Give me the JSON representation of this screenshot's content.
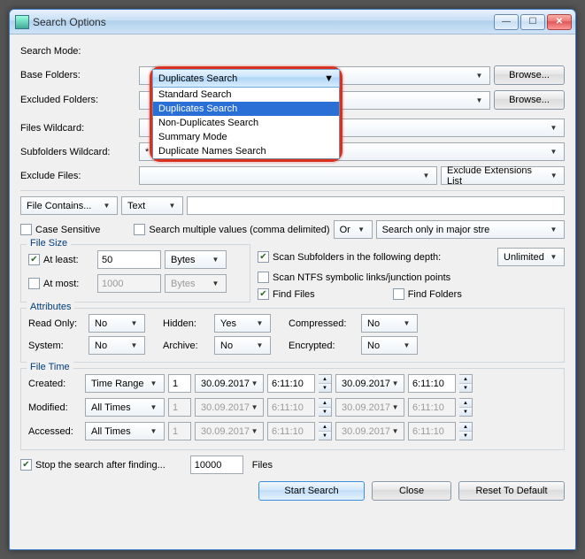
{
  "window": {
    "title": "Search Options"
  },
  "labels": {
    "searchMode": "Search Mode:",
    "baseFolders": "Base Folders:",
    "excludedFolders": "Excluded Folders:",
    "filesWildcard": "Files Wildcard:",
    "subfoldersWildcard": "Subfolders Wildcard:",
    "excludeFiles": "Exclude Files:",
    "fileSize": "File Size",
    "attributes": "Attributes",
    "fileTime": "File Time",
    "readOnly": "Read Only:",
    "hidden": "Hidden:",
    "compressed": "Compressed:",
    "system": "System:",
    "archive": "Archive:",
    "encrypted": "Encrypted:",
    "created": "Created:",
    "modified": "Modified:",
    "accessed": "Accessed:",
    "files": "Files"
  },
  "dropdown": {
    "selected": "Duplicates Search",
    "options": [
      "Standard Search",
      "Duplicates Search",
      "Non-Duplicates Search",
      "Summary Mode",
      "Duplicate Names Search"
    ]
  },
  "buttons": {
    "browse": "Browse...",
    "startSearch": "Start Search",
    "close": "Close",
    "resetDefault": "Reset To Default"
  },
  "values": {
    "subfoldersWildcard": "*",
    "ghostText": "Text",
    "excludeExtList": "Exclude Extensions List",
    "fileContains": "File Contains...",
    "fileContainsType": "Text",
    "or": "Or",
    "searchOnlyMajor": "Search only in major stre",
    "atLeast": "50",
    "atLeastUnit": "Bytes",
    "atMost": "1000",
    "atMostUnit": "Bytes",
    "scanDepth": "Unlimited",
    "stopAfter": "10000",
    "date": "30.09.2017",
    "time": "6:11:10",
    "num1": "1",
    "timeRange": "Time Range",
    "allTimes": "All Times",
    "no": "No",
    "yes": "Yes"
  },
  "checkboxes": {
    "caseSensitive": "Case Sensitive",
    "searchMultiple": "Search multiple values (comma delimited)",
    "atLeast": "At least:",
    "atMost": "At most:",
    "scanSubfolders": "Scan Subfolders in the following depth:",
    "scanNTFS": "Scan NTFS symbolic links/junction points",
    "findFiles": "Find Files",
    "findFolders": "Find Folders",
    "stopSearch": "Stop the search after finding..."
  }
}
